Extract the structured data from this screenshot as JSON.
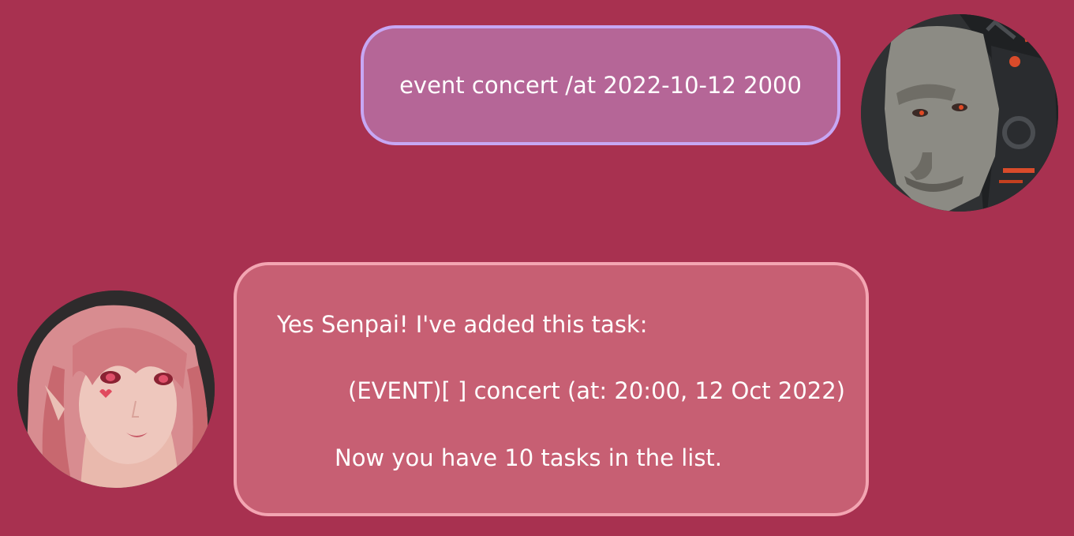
{
  "colors": {
    "background": "#a83150",
    "user_bubble_fill": "#b56697",
    "user_bubble_border": "#c7a7f4",
    "bot_bubble_fill": "#c75f73",
    "bot_bubble_border": "#f3a5b2",
    "text": "#ffffff"
  },
  "user_message": {
    "text": "event concert /at 2022-10-12 2000",
    "avatar_icon": "user-avatar-cyborg"
  },
  "bot_message": {
    "line1": "Yes Senpai! I've added this task:",
    "line2": "(EVENT)[ ] concert (at: 20:00, 12 Oct 2022)",
    "line3": "Now you have 10 tasks in the list.",
    "avatar_icon": "bot-avatar-anime-girl"
  }
}
